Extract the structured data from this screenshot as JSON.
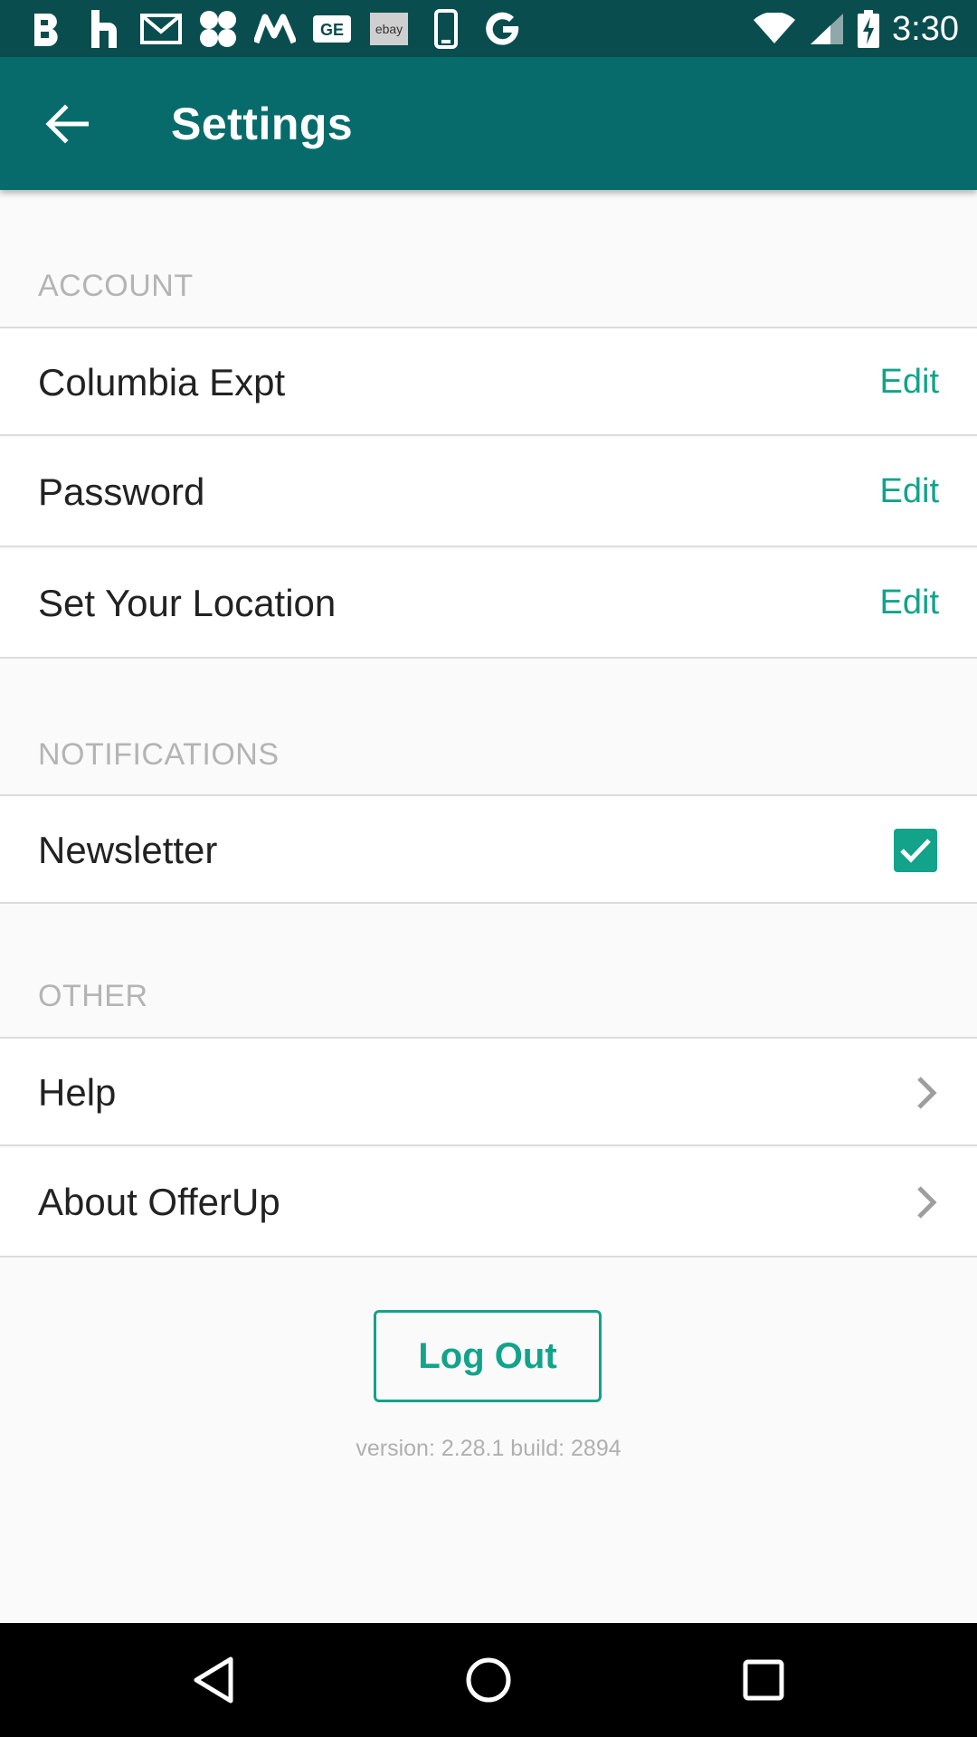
{
  "status_bar": {
    "time": "3:30",
    "notification_icons": [
      "b-icon",
      "houzz-icon",
      "gmail-icon",
      "app-cross-icon",
      "m-icon",
      "ge-icon",
      "ebay-icon",
      "phone-icon",
      "google-icon"
    ],
    "ebay_text": "ebay"
  },
  "app_bar": {
    "title": "Settings"
  },
  "sections": {
    "account": {
      "header": "ACCOUNT",
      "rows": [
        {
          "label": "Columbia Expt",
          "action": "Edit"
        },
        {
          "label": "Password",
          "action": "Edit"
        },
        {
          "label": "Set Your Location",
          "action": "Edit"
        }
      ]
    },
    "notifications": {
      "header": "NOTIFICATIONS",
      "rows": [
        {
          "label": "Newsletter",
          "checked": true
        }
      ]
    },
    "other": {
      "header": "OTHER",
      "rows": [
        {
          "label": "Help"
        },
        {
          "label": "About OfferUp"
        }
      ]
    }
  },
  "logout": {
    "label": "Log Out"
  },
  "version_text": "version: 2.28.1  build: 2894",
  "colors": {
    "status_bar": "#0a4d4f",
    "app_bar": "#076b6b",
    "accent": "#12a38a",
    "background": "#fafafa"
  }
}
